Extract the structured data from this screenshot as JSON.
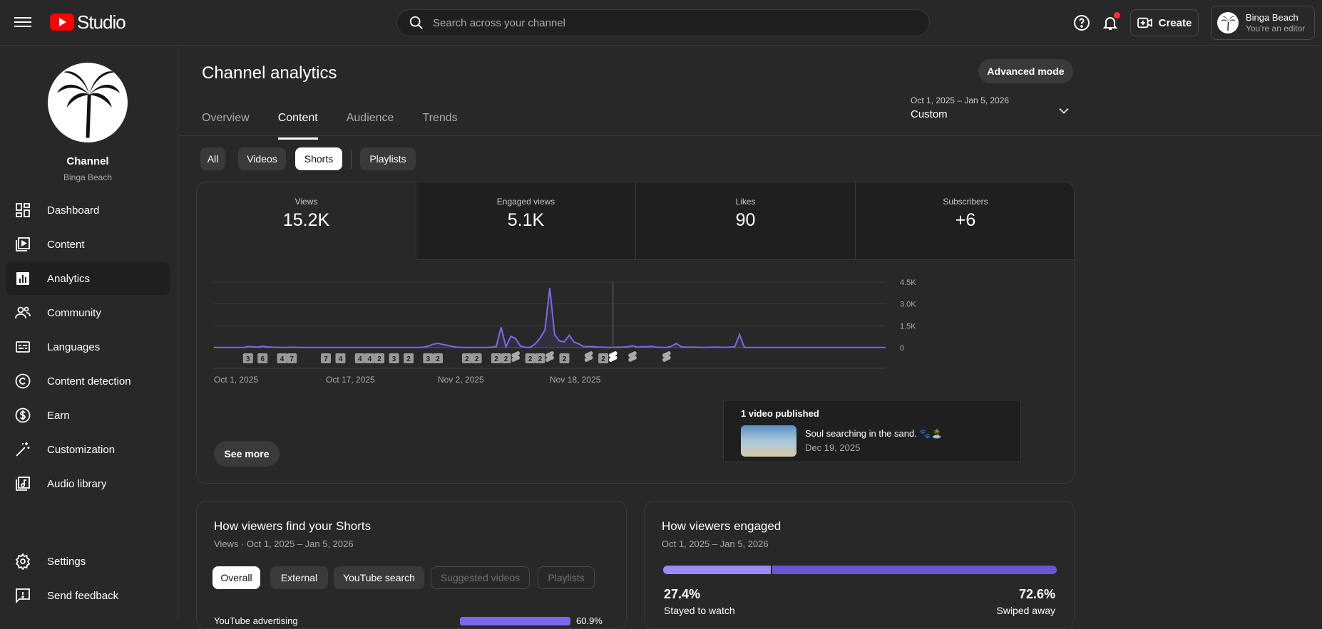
{
  "topbar": {
    "logo_text": "Studio",
    "search_placeholder": "Search across your channel",
    "create_label": "Create",
    "account_name": "Binga Beach",
    "account_role": "You're an editor"
  },
  "sidebar": {
    "channel_title": "Channel",
    "channel_name": "Binga Beach",
    "items": [
      {
        "label": "Dashboard",
        "icon": "dashboard-icon"
      },
      {
        "label": "Content",
        "icon": "content-icon"
      },
      {
        "label": "Analytics",
        "icon": "analytics-icon",
        "active": true
      },
      {
        "label": "Community",
        "icon": "community-icon"
      },
      {
        "label": "Languages",
        "icon": "languages-icon"
      },
      {
        "label": "Content detection",
        "icon": "copyright-icon"
      },
      {
        "label": "Earn",
        "icon": "dollar-icon"
      },
      {
        "label": "Customization",
        "icon": "magic-wand-icon"
      },
      {
        "label": "Audio library",
        "icon": "audio-library-icon"
      }
    ],
    "settings_label": "Settings",
    "feedback_label": "Send feedback"
  },
  "main": {
    "title": "Channel analytics",
    "advanced_mode": "Advanced mode",
    "tabs": [
      "Overview",
      "Content",
      "Audience",
      "Trends"
    ],
    "active_tab": "Content",
    "date_range": "Oct 1, 2025 – Jan 5, 2026",
    "date_preset": "Custom",
    "filters": [
      "All",
      "Videos",
      "Shorts",
      "Playlists"
    ],
    "active_filter": "Shorts"
  },
  "metrics": [
    {
      "label": "Views",
      "value": "15.2K"
    },
    {
      "label": "Engaged views",
      "value": "5.1K"
    },
    {
      "label": "Likes",
      "value": "90"
    },
    {
      "label": "Subscribers",
      "value": "+6"
    }
  ],
  "chart_data": {
    "type": "line",
    "series": [
      {
        "name": "Views",
        "color": "#7b68ee",
        "values": [
          10,
          10,
          10,
          10,
          10,
          10,
          12,
          80,
          60,
          40,
          100,
          50,
          30,
          25,
          10,
          20,
          30,
          20,
          15,
          10,
          10,
          10,
          10,
          10,
          10,
          10,
          10,
          10,
          10,
          10,
          10,
          10,
          10,
          10,
          10,
          10,
          10,
          10,
          10,
          10,
          10,
          10,
          10,
          30,
          100,
          230,
          300,
          220,
          150,
          80,
          30,
          20,
          10,
          10,
          10,
          10,
          10,
          30,
          70,
          1400,
          60,
          780,
          620,
          100,
          20,
          20,
          260,
          650,
          1200,
          4100,
          900,
          450,
          400,
          850,
          380,
          250,
          60,
          80,
          60,
          40,
          30,
          20,
          20,
          30,
          40,
          60,
          120,
          40,
          60,
          70,
          90,
          30,
          20,
          10,
          100,
          280,
          60,
          30,
          40,
          30,
          20,
          20,
          30,
          40,
          30,
          20,
          40,
          60,
          900,
          10,
          10,
          10,
          10,
          10,
          10,
          10,
          10,
          10,
          10,
          10,
          10,
          10,
          10,
          10,
          10,
          10,
          10,
          10,
          10,
          10,
          10,
          10,
          10,
          10,
          10,
          10,
          10,
          10,
          10
        ]
      }
    ],
    "x_tick_labels": [
      "Oct 1, 2025",
      "Oct 17, 2025",
      "Nov 2, 2025",
      "Nov 18, 2025"
    ],
    "y_tick_labels": [
      "0",
      "1.5K",
      "3.0K",
      "4.5K"
    ],
    "ylim": [
      0,
      4500
    ],
    "grid": true,
    "markers": [
      {
        "label": "3",
        "x": 7
      },
      {
        "label": "6",
        "x": 10
      },
      {
        "label": "4",
        "x": 14
      },
      {
        "label": "7",
        "x": 16
      },
      {
        "label": "7",
        "x": 23
      },
      {
        "label": "4",
        "x": 26
      },
      {
        "label": "4",
        "x": 30
      },
      {
        "label": "4",
        "x": 32
      },
      {
        "label": "2",
        "x": 34
      },
      {
        "label": "3",
        "x": 37
      },
      {
        "label": "2",
        "x": 40
      },
      {
        "label": "3",
        "x": 44
      },
      {
        "label": "2",
        "x": 46
      },
      {
        "label": "2",
        "x": 52
      },
      {
        "label": "2",
        "x": 54
      },
      {
        "label": "2",
        "x": 58
      },
      {
        "label": "2",
        "x": 60
      },
      {
        "label": "",
        "x": 62,
        "icon": "shorts-icon"
      },
      {
        "label": "2",
        "x": 65
      },
      {
        "label": "2",
        "x": 67
      },
      {
        "label": "",
        "x": 69,
        "icon": "shorts-icon"
      },
      {
        "label": "2",
        "x": 72
      },
      {
        "label": "",
        "x": 77,
        "icon": "shorts-icon"
      },
      {
        "label": "2",
        "x": 80
      },
      {
        "label": "",
        "x": 82,
        "icon": "shorts-icon",
        "highlight": true
      },
      {
        "label": "",
        "x": 86,
        "icon": "shorts-icon"
      },
      {
        "label": "",
        "x": 93,
        "icon": "shorts-icon"
      }
    ],
    "cursor_x": 82
  },
  "popup": {
    "heading": "1 video published",
    "video_title": "Soul searching in the sand. 🐾🏝️",
    "video_date": "Dec 19, 2025"
  },
  "see_more": "See more",
  "find_card": {
    "title": "How viewers find your Shorts",
    "subtitle": "Views · Oct 1, 2025 – Jan 5, 2026",
    "chips": [
      "Overall",
      "External",
      "YouTube search",
      "Suggested videos",
      "Playlists"
    ],
    "row_label": "YouTube advertising",
    "row_value": 60.9,
    "row_percent": "60.9%"
  },
  "engaged_card": {
    "title": "How viewers engaged",
    "subtitle": "Oct 1, 2025 – Jan 5, 2026",
    "stayed_pct": "27.4%",
    "stayed_label": "Stayed to watch",
    "stayed_value": 27.4,
    "swiped_pct": "72.6%",
    "swiped_label": "Swiped away"
  }
}
